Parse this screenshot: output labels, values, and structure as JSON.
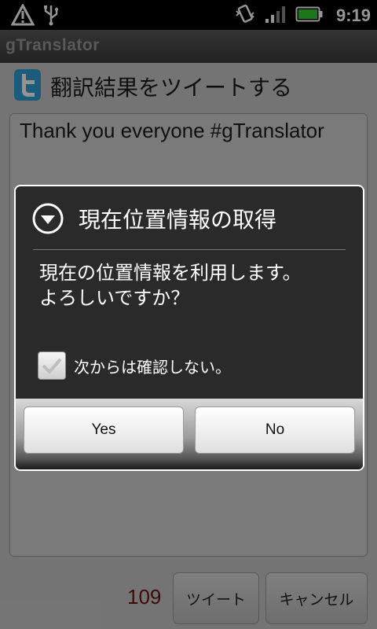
{
  "status_bar": {
    "time": "9:19",
    "icons": [
      "warning-icon",
      "usb-icon",
      "vibrate-icon",
      "signal-icon",
      "battery-icon"
    ],
    "battery_color": "#33cc33"
  },
  "app": {
    "title": "gTranslator"
  },
  "tweet": {
    "header": "翻訳結果をツイートする",
    "text": "Thank you everyone #gTranslator",
    "remaining": "109",
    "tweet_button": "ツイート",
    "cancel_button": "キャンセル",
    "brand_color": "#2f9fd6"
  },
  "dialog": {
    "title": "現在位置情報の取得",
    "message": "現在の位置情報を利用します。よろしいですか？",
    "checkbox_label": "次からは確認しない。",
    "checkbox_checked": false,
    "yes_label": "Yes",
    "no_label": "No"
  }
}
